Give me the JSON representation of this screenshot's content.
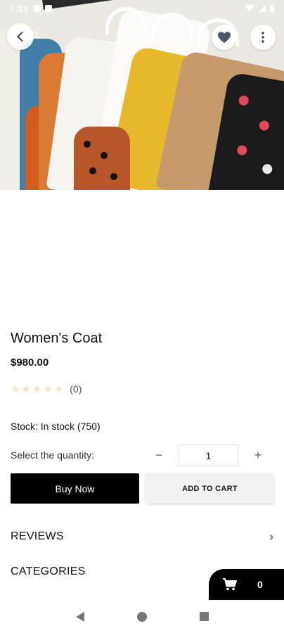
{
  "status_bar": {
    "time": "7:23"
  },
  "product": {
    "title": "Women's Coat",
    "price": "$980.00",
    "rating_stars": 0,
    "rating_max": 5,
    "rating_count": "(0)",
    "stock": "Stock: In stock (750)"
  },
  "quantity": {
    "label": "Select the quantity:",
    "minus": "−",
    "value": "1",
    "plus": "+"
  },
  "actions": {
    "buy_now": "Buy Now",
    "add_to_cart": "ADD TO CART"
  },
  "sections": {
    "reviews": "REVIEWS",
    "categories": "CATEGORIES"
  },
  "cart": {
    "count": "0"
  },
  "icons": {
    "back": "chevron-left-icon",
    "favorite": "heart-icon",
    "more": "more-vertical-icon",
    "cart": "cart-icon"
  },
  "colors": {
    "primary_button": "#000000",
    "secondary_button": "#f2f2f2",
    "star_empty": "#f7e3c3",
    "favorite_icon": "#4a5a6e"
  }
}
